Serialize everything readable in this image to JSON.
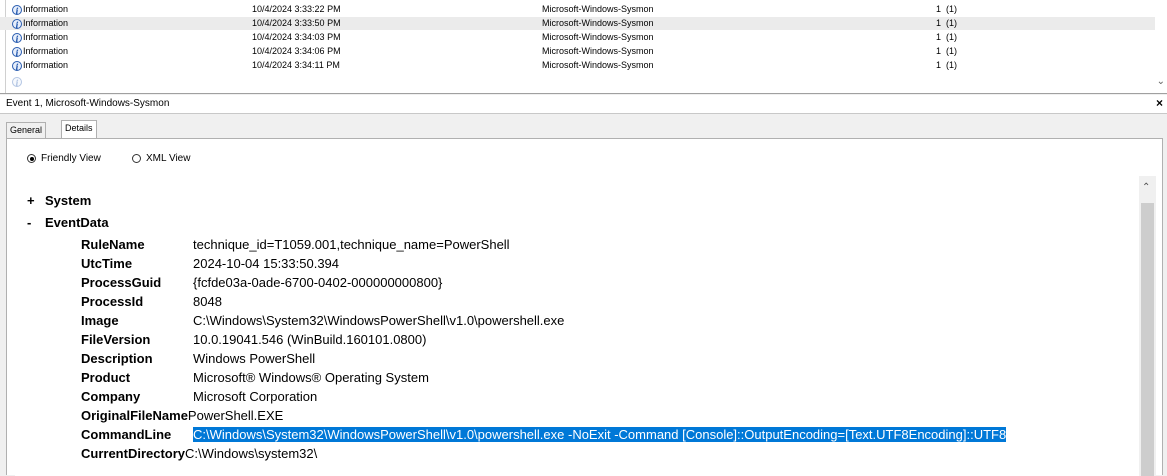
{
  "event_list": {
    "rows": [
      {
        "level": "Information",
        "date": "10/4/2024 3:33:22 PM",
        "source": "Microsoft-Windows-Sysmon",
        "id": "1",
        "task": "(1)",
        "selected": false
      },
      {
        "level": "Information",
        "date": "10/4/2024 3:33:50 PM",
        "source": "Microsoft-Windows-Sysmon",
        "id": "1",
        "task": "(1)",
        "selected": true
      },
      {
        "level": "Information",
        "date": "10/4/2024 3:34:03 PM",
        "source": "Microsoft-Windows-Sysmon",
        "id": "1",
        "task": "(1)",
        "selected": false
      },
      {
        "level": "Information",
        "date": "10/4/2024 3:34:06 PM",
        "source": "Microsoft-Windows-Sysmon",
        "id": "1",
        "task": "(1)",
        "selected": false
      },
      {
        "level": "Information",
        "date": "10/4/2024 3:34:11 PM",
        "source": "Microsoft-Windows-Sysmon",
        "id": "1",
        "task": "(1)",
        "selected": false
      }
    ]
  },
  "event_panel": {
    "title": "Event 1, Microsoft-Windows-Sysmon",
    "close_label": "×",
    "tabs": [
      {
        "label": "General",
        "active": false
      },
      {
        "label": "Details",
        "active": true
      }
    ],
    "view_options": {
      "friendly": "Friendly View",
      "xml": "XML View",
      "selected": "friendly"
    },
    "sections": {
      "system": {
        "expander": "+",
        "label": "System"
      },
      "eventdata": {
        "expander": "-",
        "label": "EventData"
      }
    },
    "properties": [
      {
        "name": "RuleName",
        "value": "technique_id=T1059.001,technique_name=PowerShell"
      },
      {
        "name": "UtcTime",
        "value": "2024-10-04 15:33:50.394"
      },
      {
        "name": "ProcessGuid",
        "value": "{fcfde03a-0ade-6700-0402-000000000800}"
      },
      {
        "name": "ProcessId",
        "value": "8048"
      },
      {
        "name": "Image",
        "value": "C:\\Windows\\System32\\WindowsPowerShell\\v1.0\\powershell.exe"
      },
      {
        "name": "FileVersion",
        "value": "10.0.19041.546 (WinBuild.160101.0800)"
      },
      {
        "name": "Description",
        "value": "Windows PowerShell"
      },
      {
        "name": "Product",
        "value": "Microsoft® Windows® Operating System"
      },
      {
        "name": "Company",
        "value": "Microsoft Corporation"
      },
      {
        "name": "OriginalFileName",
        "value": "PowerShell.EXE"
      },
      {
        "name": "CommandLine",
        "value": "C:\\Windows\\System32\\WindowsPowerShell\\v1.0\\powershell.exe -NoExit -Command [Console]::OutputEncoding=[Text.UTF8Encoding]::UTF8"
      },
      {
        "name": "CurrentDirectory",
        "value": "C:\\Windows\\system32\\"
      }
    ]
  },
  "colors": {
    "selection": "#0078d7",
    "selected_row": "#ebebeb"
  }
}
